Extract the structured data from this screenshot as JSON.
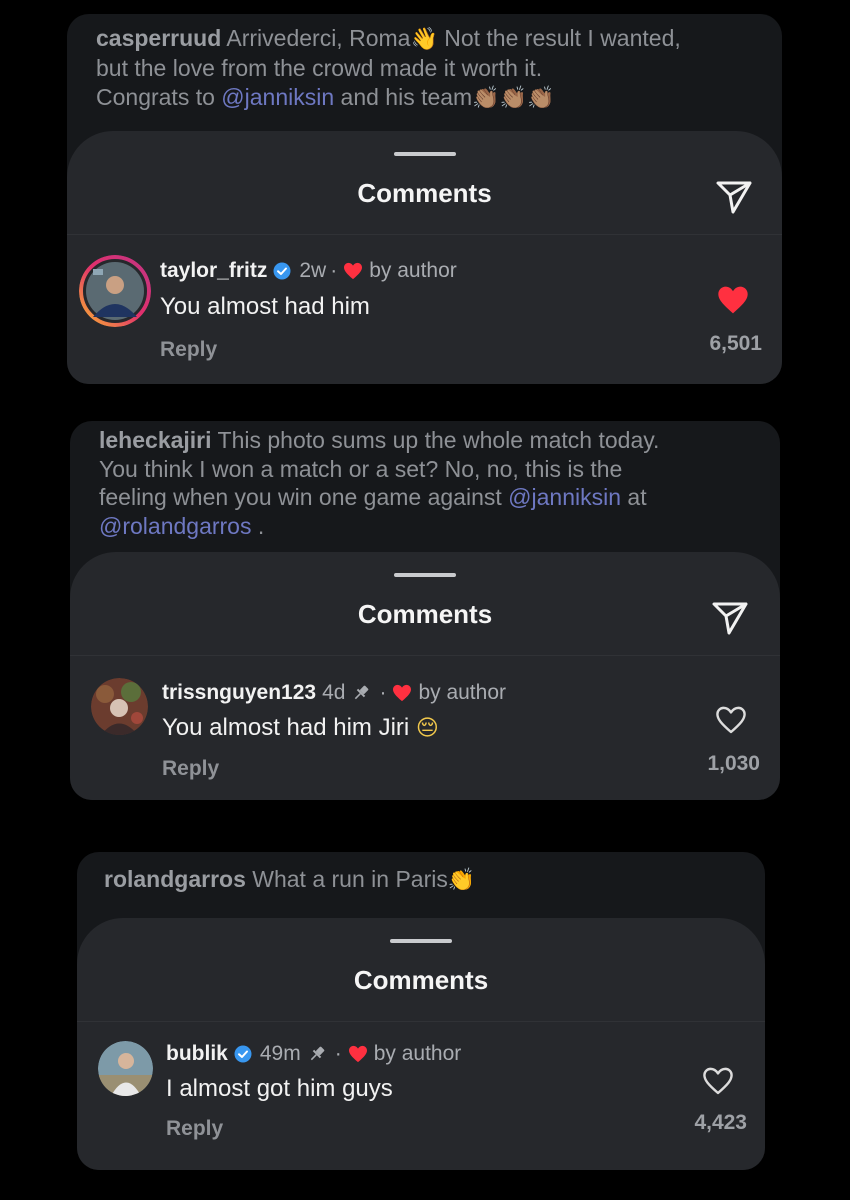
{
  "posts": [
    {
      "caption": {
        "username": "casperruud",
        "line1_text": "Arrivederci, Roma",
        "line1_emoji": "👋",
        "line1_rest": "Not the result I wanted,",
        "line2": "but the love from the crowd made it worth it.",
        "line3_pre": "Congrats to",
        "line3_mention": "@janniksin",
        "line3_post": "and his team",
        "line3_emojis": "👏🏽👏🏽👏🏽"
      },
      "sheet_title": "Comments",
      "comment": {
        "username": "taylor_fritz",
        "verified": true,
        "time": "2w",
        "by_author": "by author",
        "text": "You almost had him",
        "reply_label": "Reply",
        "likes": "6,501",
        "liked": true
      }
    },
    {
      "caption": {
        "username": "leheckajiri",
        "line1_text": "This photo sums up the whole match today.",
        "line2": "You think I won a match or a set? No, no, this is the",
        "line3_pre": "feeling when you win one game against",
        "line3_mention": "@janniksin",
        "line3_post": "at",
        "line4_mention": "@rolandgarros",
        "line4_post": "."
      },
      "sheet_title": "Comments",
      "comment": {
        "username": "trissnguyen123",
        "time": "4d",
        "by_author": "by author",
        "text": "You almost had him Jiri",
        "text_emoji": "😔",
        "reply_label": "Reply",
        "likes": "1,030",
        "liked": false
      }
    },
    {
      "caption": {
        "username": "rolandgarros",
        "line1_text": "What a run in Paris",
        "line1_emoji": "👏"
      },
      "sheet_title": "Comments",
      "comment": {
        "username": "bublik",
        "verified": true,
        "time": "49m",
        "by_author": "by author",
        "text": "I almost got him guys",
        "reply_label": "Reply",
        "likes": "4,423",
        "liked": false
      }
    }
  ],
  "icons": {
    "send": "paper-plane-icon",
    "like": "heart-icon",
    "verified": "verified-badge-icon",
    "pin": "pin-icon"
  },
  "colors": {
    "background": "#000000",
    "card": "#16181b",
    "sheet": "#26282c",
    "mention": "#6e78c2",
    "verified": "#3897f0",
    "heart": "#ff3040"
  }
}
